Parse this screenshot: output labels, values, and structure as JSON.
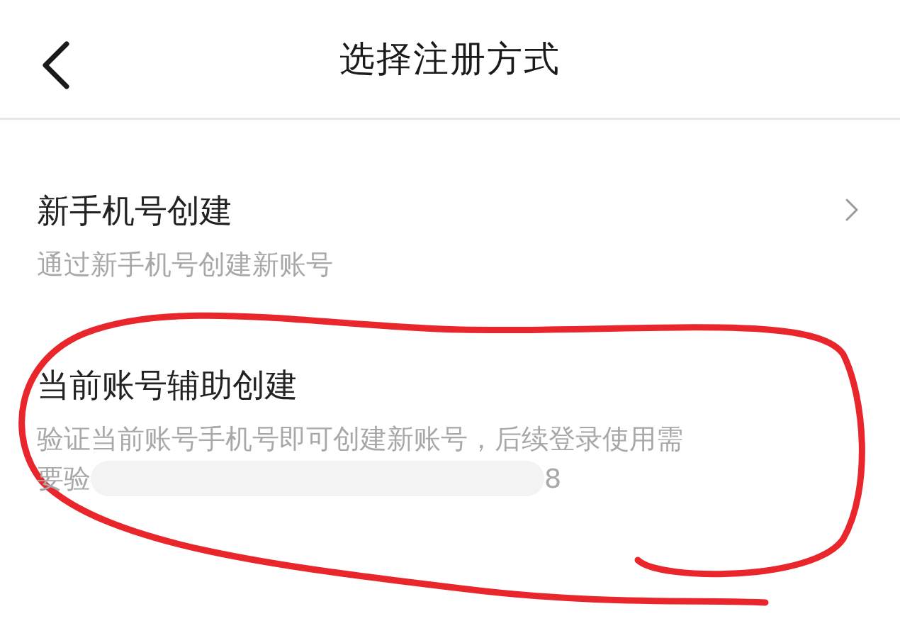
{
  "header": {
    "title": "选择注册方式"
  },
  "options": [
    {
      "title": "新手机号创建",
      "lines": [
        "通过新手机号创建新账号"
      ],
      "chevron": true,
      "redacted": false
    },
    {
      "title": "当前账号辅助创建",
      "lines": [
        "验证当前账号手机号即可创建新账号，后续登录使用需",
        "要验",
        "8"
      ],
      "chevron": false,
      "redacted": true
    }
  ],
  "annotation": {
    "kind": "circle",
    "color": "#e8262b"
  }
}
